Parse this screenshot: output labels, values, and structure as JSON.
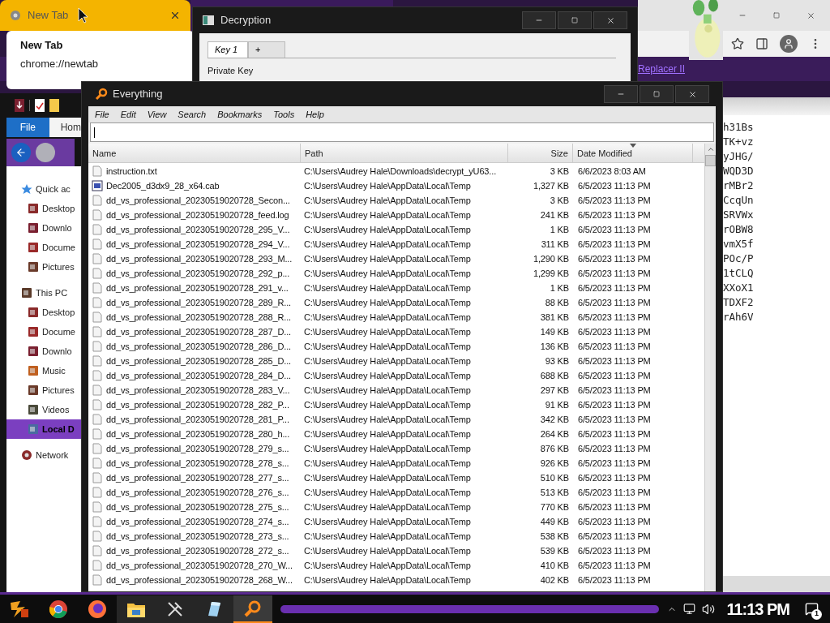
{
  "browser": {
    "tab": {
      "title": "New Tab"
    },
    "hover_card": {
      "title": "New Tab",
      "url": "chrome://newtab"
    },
    "bookmark": "Replacer II"
  },
  "decryption": {
    "title": "Decryption",
    "tabs": [
      {
        "label": "Key 1",
        "selected": true
      },
      {
        "label": "+",
        "selected": false
      }
    ],
    "field_label": "Private Key"
  },
  "explorer": {
    "ribbon_tabs": [
      {
        "label": "File",
        "selected": true
      },
      {
        "label": "Hom",
        "selected": false
      }
    ],
    "nav": [
      {
        "label": "Quick ac",
        "kind": "star",
        "selected": false,
        "children": [
          {
            "label": "Desktop",
            "kind": "desktop",
            "selected": false
          },
          {
            "label": "Downlo",
            "kind": "download",
            "selected": false
          },
          {
            "label": "Docume",
            "kind": "document",
            "selected": false
          },
          {
            "label": "Pictures",
            "kind": "pictures",
            "selected": false
          }
        ]
      },
      {
        "label": "This PC",
        "kind": "pc",
        "selected": false,
        "children": [
          {
            "label": "Desktop",
            "kind": "desktop",
            "selected": false
          },
          {
            "label": "Docume",
            "kind": "document",
            "selected": false
          },
          {
            "label": "Downlo",
            "kind": "download",
            "selected": false
          },
          {
            "label": "Music",
            "kind": "music",
            "selected": false
          },
          {
            "label": "Pictures",
            "kind": "pictures",
            "selected": false
          },
          {
            "label": "Videos",
            "kind": "videos",
            "selected": false
          },
          {
            "label": "Local D",
            "kind": "drive",
            "selected": true
          }
        ]
      },
      {
        "label": "Network",
        "kind": "network",
        "selected": false
      }
    ]
  },
  "everything": {
    "title": "Everything",
    "menu": [
      "File",
      "Edit",
      "View",
      "Search",
      "Bookmarks",
      "Tools",
      "Help"
    ],
    "columns": [
      {
        "label": "Name",
        "sorted": false
      },
      {
        "label": "Path",
        "sorted": false
      },
      {
        "label": "Size",
        "sorted": false
      },
      {
        "label": "Date Modified",
        "sorted": true
      }
    ],
    "rows": [
      {
        "kind": "text",
        "name": "instruction.txt",
        "path": "C:\\Users\\Audrey Hale\\Downloads\\decrypt_yU63...",
        "size": "3 KB",
        "modified": "6/6/2023 8:03 AM"
      },
      {
        "kind": "cab",
        "name": "Dec2005_d3dx9_28_x64.cab",
        "path": "C:\\Users\\Audrey Hale\\AppData\\Local\\Temp",
        "size": "1,327 KB",
        "modified": "6/5/2023 11:13 PM"
      },
      {
        "kind": "text",
        "name": "dd_vs_professional_20230519020728_Secon...",
        "path": "C:\\Users\\Audrey Hale\\AppData\\Local\\Temp",
        "size": "3 KB",
        "modified": "6/5/2023 11:13 PM"
      },
      {
        "kind": "text",
        "name": "dd_vs_professional_20230519020728_feed.log",
        "path": "C:\\Users\\Audrey Hale\\AppData\\Local\\Temp",
        "size": "241 KB",
        "modified": "6/5/2023 11:13 PM"
      },
      {
        "kind": "text",
        "name": "dd_vs_professional_20230519020728_295_V...",
        "path": "C:\\Users\\Audrey Hale\\AppData\\Local\\Temp",
        "size": "1 KB",
        "modified": "6/5/2023 11:13 PM"
      },
      {
        "kind": "text",
        "name": "dd_vs_professional_20230519020728_294_V...",
        "path": "C:\\Users\\Audrey Hale\\AppData\\Local\\Temp",
        "size": "311 KB",
        "modified": "6/5/2023 11:13 PM"
      },
      {
        "kind": "text",
        "name": "dd_vs_professional_20230519020728_293_M...",
        "path": "C:\\Users\\Audrey Hale\\AppData\\Local\\Temp",
        "size": "1,290 KB",
        "modified": "6/5/2023 11:13 PM"
      },
      {
        "kind": "text",
        "name": "dd_vs_professional_20230519020728_292_p...",
        "path": "C:\\Users\\Audrey Hale\\AppData\\Local\\Temp",
        "size": "1,299 KB",
        "modified": "6/5/2023 11:13 PM"
      },
      {
        "kind": "text",
        "name": "dd_vs_professional_20230519020728_291_v...",
        "path": "C:\\Users\\Audrey Hale\\AppData\\Local\\Temp",
        "size": "1 KB",
        "modified": "6/5/2023 11:13 PM"
      },
      {
        "kind": "text",
        "name": "dd_vs_professional_20230519020728_289_R...",
        "path": "C:\\Users\\Audrey Hale\\AppData\\Local\\Temp",
        "size": "88 KB",
        "modified": "6/5/2023 11:13 PM"
      },
      {
        "kind": "text",
        "name": "dd_vs_professional_20230519020728_288_R...",
        "path": "C:\\Users\\Audrey Hale\\AppData\\Local\\Temp",
        "size": "381 KB",
        "modified": "6/5/2023 11:13 PM"
      },
      {
        "kind": "text",
        "name": "dd_vs_professional_20230519020728_287_D...",
        "path": "C:\\Users\\Audrey Hale\\AppData\\Local\\Temp",
        "size": "149 KB",
        "modified": "6/5/2023 11:13 PM"
      },
      {
        "kind": "text",
        "name": "dd_vs_professional_20230519020728_286_D...",
        "path": "C:\\Users\\Audrey Hale\\AppData\\Local\\Temp",
        "size": "136 KB",
        "modified": "6/5/2023 11:13 PM"
      },
      {
        "kind": "text",
        "name": "dd_vs_professional_20230519020728_285_D...",
        "path": "C:\\Users\\Audrey Hale\\AppData\\Local\\Temp",
        "size": "93 KB",
        "modified": "6/5/2023 11:13 PM"
      },
      {
        "kind": "text",
        "name": "dd_vs_professional_20230519020728_284_D...",
        "path": "C:\\Users\\Audrey Hale\\AppData\\Local\\Temp",
        "size": "688 KB",
        "modified": "6/5/2023 11:13 PM"
      },
      {
        "kind": "text",
        "name": "dd_vs_professional_20230519020728_283_V...",
        "path": "C:\\Users\\Audrey Hale\\AppData\\Local\\Temp",
        "size": "297 KB",
        "modified": "6/5/2023 11:13 PM"
      },
      {
        "kind": "text",
        "name": "dd_vs_professional_20230519020728_282_P...",
        "path": "C:\\Users\\Audrey Hale\\AppData\\Local\\Temp",
        "size": "91 KB",
        "modified": "6/5/2023 11:13 PM"
      },
      {
        "kind": "text",
        "name": "dd_vs_professional_20230519020728_281_P...",
        "path": "C:\\Users\\Audrey Hale\\AppData\\Local\\Temp",
        "size": "342 KB",
        "modified": "6/5/2023 11:13 PM"
      },
      {
        "kind": "text",
        "name": "dd_vs_professional_20230519020728_280_h...",
        "path": "C:\\Users\\Audrey Hale\\AppData\\Local\\Temp",
        "size": "264 KB",
        "modified": "6/5/2023 11:13 PM"
      },
      {
        "kind": "text",
        "name": "dd_vs_professional_20230519020728_279_s...",
        "path": "C:\\Users\\Audrey Hale\\AppData\\Local\\Temp",
        "size": "876 KB",
        "modified": "6/5/2023 11:13 PM"
      },
      {
        "kind": "text",
        "name": "dd_vs_professional_20230519020728_278_s...",
        "path": "C:\\Users\\Audrey Hale\\AppData\\Local\\Temp",
        "size": "926 KB",
        "modified": "6/5/2023 11:13 PM"
      },
      {
        "kind": "text",
        "name": "dd_vs_professional_20230519020728_277_s...",
        "path": "C:\\Users\\Audrey Hale\\AppData\\Local\\Temp",
        "size": "510 KB",
        "modified": "6/5/2023 11:13 PM"
      },
      {
        "kind": "text",
        "name": "dd_vs_professional_20230519020728_276_s...",
        "path": "C:\\Users\\Audrey Hale\\AppData\\Local\\Temp",
        "size": "513 KB",
        "modified": "6/5/2023 11:13 PM"
      },
      {
        "kind": "text",
        "name": "dd_vs_professional_20230519020728_275_s...",
        "path": "C:\\Users\\Audrey Hale\\AppData\\Local\\Temp",
        "size": "770 KB",
        "modified": "6/5/2023 11:13 PM"
      },
      {
        "kind": "text",
        "name": "dd_vs_professional_20230519020728_274_s...",
        "path": "C:\\Users\\Audrey Hale\\AppData\\Local\\Temp",
        "size": "449 KB",
        "modified": "6/5/2023 11:13 PM"
      },
      {
        "kind": "text",
        "name": "dd_vs_professional_20230519020728_273_s...",
        "path": "C:\\Users\\Audrey Hale\\AppData\\Local\\Temp",
        "size": "538 KB",
        "modified": "6/5/2023 11:13 PM"
      },
      {
        "kind": "text",
        "name": "dd_vs_professional_20230519020728_272_s...",
        "path": "C:\\Users\\Audrey Hale\\AppData\\Local\\Temp",
        "size": "539 KB",
        "modified": "6/5/2023 11:13 PM"
      },
      {
        "kind": "text",
        "name": "dd_vs_professional_20230519020728_270_W...",
        "path": "C:\\Users\\Audrey Hale\\AppData\\Local\\Temp",
        "size": "410 KB",
        "modified": "6/5/2023 11:13 PM"
      },
      {
        "kind": "text",
        "name": "dd_vs_professional_20230519020728_268_W...",
        "path": "C:\\Users\\Audrey Hale\\AppData\\Local\\Temp",
        "size": "402 KB",
        "modified": "6/5/2023 11:13 PM"
      }
    ]
  },
  "text_window": {
    "lines": [
      "h31Bs",
      "TK+vz",
      "yJHG/",
      "WQD3D",
      "rMBr2",
      "CcqUn",
      "SRVWx",
      "rOBW8",
      "vmX5f",
      "POc/P",
      "1tCLQ",
      "XXoX1",
      "TDXF2",
      "rAh6V"
    ]
  },
  "taskbar": {
    "apps": [
      {
        "kind": "logo",
        "selected": false
      },
      {
        "kind": "chrome",
        "selected": false
      },
      {
        "kind": "firefox",
        "selected": false
      },
      {
        "kind": "folder",
        "selected": false
      },
      {
        "kind": "hammer",
        "selected": false
      },
      {
        "kind": "notepad",
        "selected": false
      },
      {
        "kind": "search",
        "selected": true
      }
    ],
    "clock": "11:13 PM",
    "notification_count": "1"
  }
}
